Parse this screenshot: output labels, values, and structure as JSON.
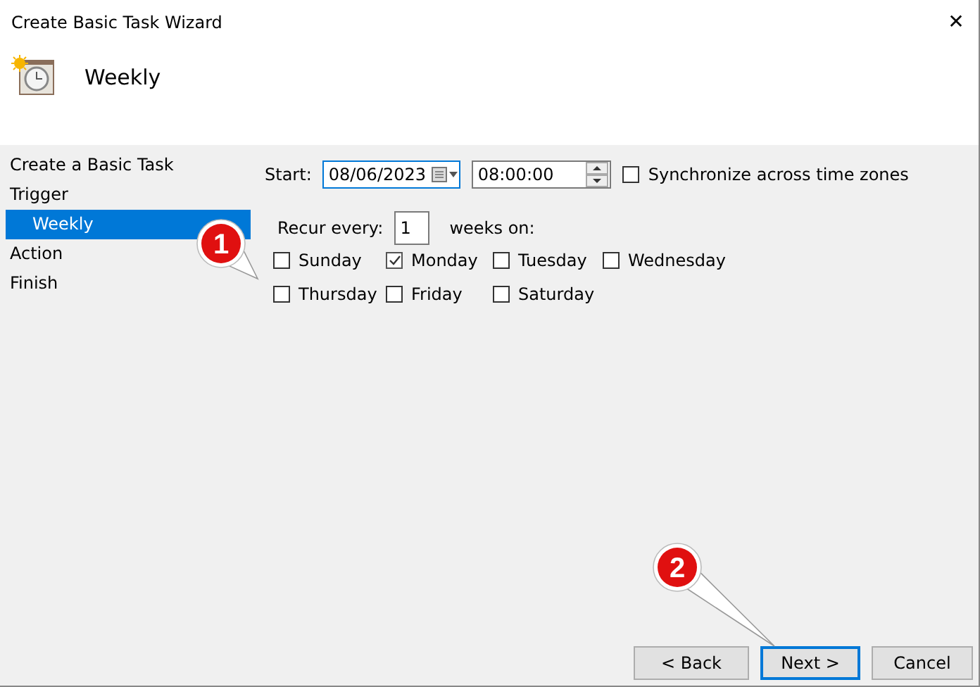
{
  "window": {
    "title": "Create Basic Task Wizard",
    "close": "✕"
  },
  "header": {
    "title": "Weekly"
  },
  "sidebar": {
    "items": [
      {
        "label": "Create a Basic Task",
        "selected": false
      },
      {
        "label": "Trigger",
        "selected": false,
        "children": [
          {
            "label": "Weekly",
            "selected": true
          }
        ]
      },
      {
        "label": "Action",
        "selected": false
      },
      {
        "label": "Finish",
        "selected": false
      }
    ]
  },
  "start": {
    "label": "Start:",
    "date": "08/06/2023",
    "time": "08:00:00",
    "sync": {
      "label": "Synchronize across time zones",
      "checked": false
    }
  },
  "recur": {
    "label": "Recur every:",
    "value": "1",
    "suffix": "weeks on:"
  },
  "days": [
    {
      "label": "Sunday",
      "checked": false
    },
    {
      "label": "Monday",
      "checked": true
    },
    {
      "label": "Tuesday",
      "checked": false
    },
    {
      "label": "Wednesday",
      "checked": false
    },
    {
      "label": "Thursday",
      "checked": false
    },
    {
      "label": "Friday",
      "checked": false
    },
    {
      "label": "Saturday",
      "checked": false
    }
  ],
  "buttons": [
    {
      "label": "< Back",
      "focused": false
    },
    {
      "label": "Next >",
      "focused": true
    },
    {
      "label": "Cancel",
      "focused": false
    }
  ],
  "callouts": [
    "1",
    "2"
  ]
}
